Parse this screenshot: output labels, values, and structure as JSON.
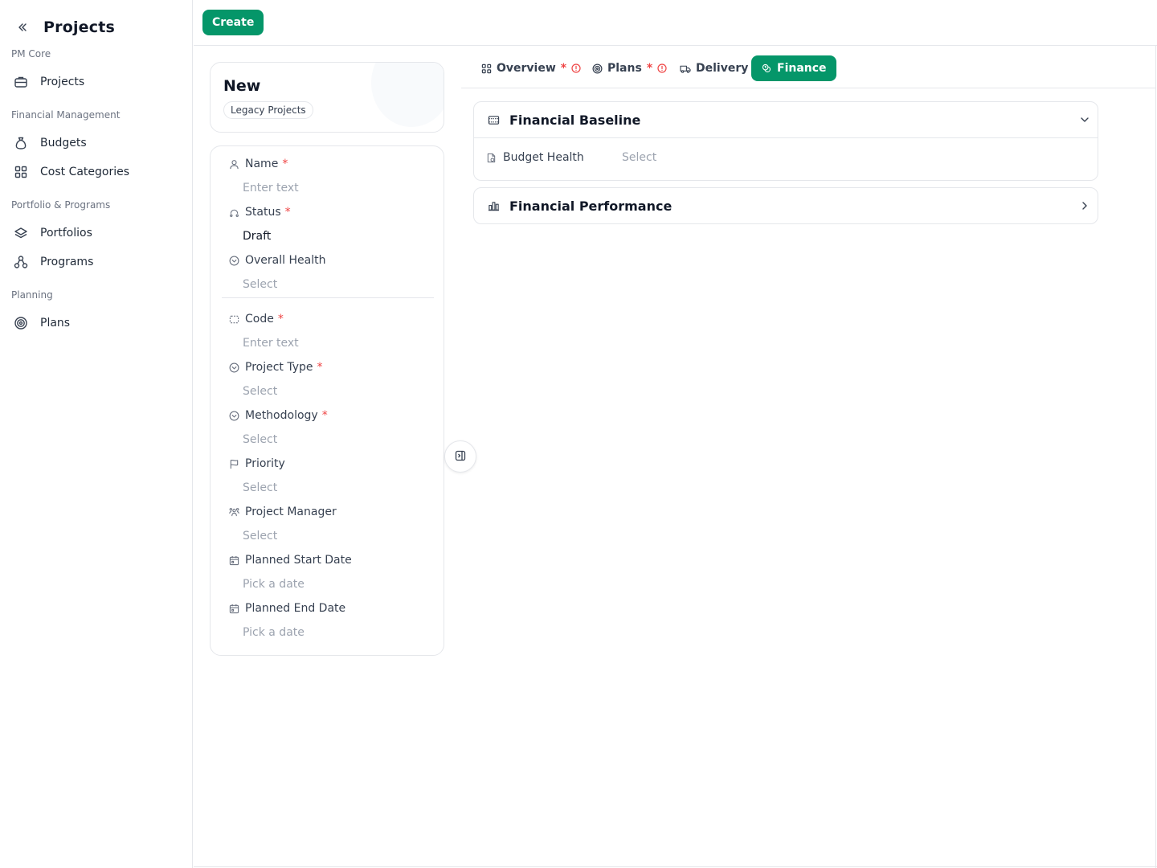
{
  "sidebar": {
    "title": "Projects",
    "collapse_icon": "chevrons-left-icon",
    "sections": [
      {
        "title": "PM Core",
        "items": [
          {
            "label": "Projects",
            "icon": "briefcase-icon"
          }
        ]
      },
      {
        "title": "Financial Management",
        "items": [
          {
            "label": "Budgets",
            "icon": "money-bag-icon"
          },
          {
            "label": "Cost Categories",
            "icon": "grid-icon"
          }
        ]
      },
      {
        "title": "Portfolio & Programs",
        "items": [
          {
            "label": "Portfolios",
            "icon": "layers-icon"
          },
          {
            "label": "Programs",
            "icon": "network-icon"
          }
        ]
      },
      {
        "title": "Planning",
        "items": [
          {
            "label": "Plans",
            "icon": "target-icon"
          }
        ]
      }
    ]
  },
  "toolbar": {
    "create_label": "Create"
  },
  "record": {
    "title": "New",
    "badge": "Legacy Projects"
  },
  "form": {
    "fields": [
      {
        "label": "Name",
        "required": "*",
        "value": "Enter text",
        "icon": "user-icon"
      },
      {
        "label": "Status",
        "required": "*",
        "value": "Draft",
        "icon": "status-icon"
      },
      {
        "label": "Overall Health",
        "required": "",
        "value": "Select",
        "icon": "circle-chevron-icon"
      },
      {
        "label": "Code",
        "required": "*",
        "value": "Enter text",
        "icon": "code-box-icon"
      },
      {
        "label": "Project Type",
        "required": "*",
        "value": "Select",
        "icon": "circle-chevron-icon"
      },
      {
        "label": "Methodology",
        "required": "*",
        "value": "Select",
        "icon": "circle-chevron-icon"
      },
      {
        "label": "Priority",
        "required": "",
        "value": "Select",
        "icon": "flag-icon"
      },
      {
        "label": "Project Manager",
        "required": "",
        "value": "Select",
        "icon": "users-icon"
      },
      {
        "label": "Planned Start Date",
        "required": "",
        "value": "Pick a date",
        "icon": "calendar-icon"
      },
      {
        "label": "Planned End Date",
        "required": "",
        "value": "Pick a date",
        "icon": "calendar-icon"
      }
    ]
  },
  "tabs": [
    {
      "label": "Overview",
      "required": "*",
      "icon": "grid-icon",
      "warning": true
    },
    {
      "label": "Plans",
      "required": "*",
      "icon": "target-icon",
      "warning": true
    },
    {
      "label": "Delivery",
      "required": "",
      "icon": "truck-icon",
      "warning": false
    },
    {
      "label": "Finance",
      "required": "",
      "icon": "coins-icon",
      "warning": false,
      "active": true
    }
  ],
  "finance": {
    "baseline": {
      "title": "Financial Baseline",
      "field_label": "Budget Health",
      "field_value": "Select"
    },
    "performance": {
      "title": "Financial Performance"
    }
  },
  "colors": {
    "accent": "#059669",
    "required": "#ef4444",
    "border": "#e5e7eb",
    "placeholder": "#9ca3af"
  }
}
